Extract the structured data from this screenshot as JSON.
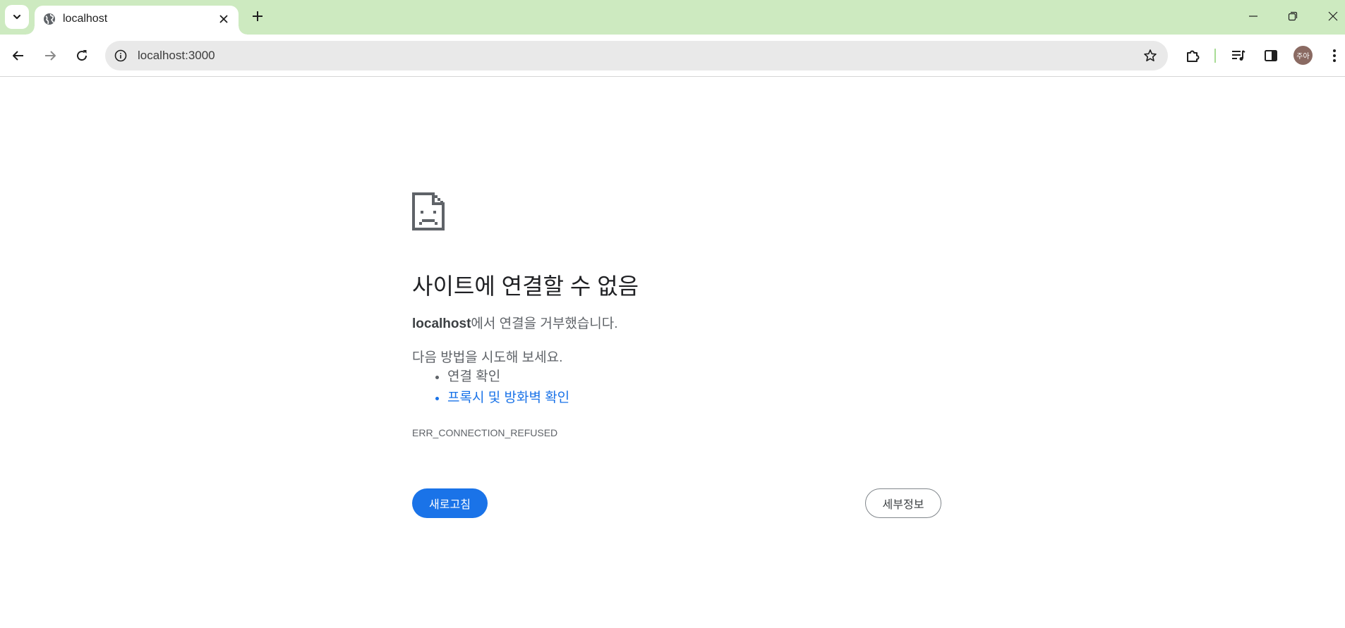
{
  "browser": {
    "tab": {
      "title": "localhost"
    },
    "address_bar": {
      "url": "localhost:3000"
    },
    "profile": {
      "avatar_text": "주아"
    },
    "colors": {
      "tabstrip": "#cdeac0",
      "accent": "#1a73e8"
    }
  },
  "icons": [
    "tab-search-icon",
    "globe-icon",
    "close-icon",
    "plus-icon",
    "minimize-icon",
    "restore-icon",
    "window-close-icon",
    "back-icon",
    "forward-icon",
    "reload-icon",
    "info-icon",
    "star-icon",
    "extensions-icon",
    "media-icon",
    "side-panel-icon",
    "more-vert-icon",
    "sad-page-icon"
  ],
  "error_page": {
    "title": "사이트에 연결할 수 없음",
    "host": "localhost",
    "description_suffix": "에서 연결을 거부했습니다.",
    "try_heading": "다음 방법을 시도해 보세요.",
    "suggestions": [
      {
        "label": "연결 확인"
      },
      {
        "label": "프록시 및 방화벽 확인"
      }
    ],
    "error_code": "ERR_CONNECTION_REFUSED",
    "reload_label": "새로고침",
    "details_label": "세부정보"
  }
}
